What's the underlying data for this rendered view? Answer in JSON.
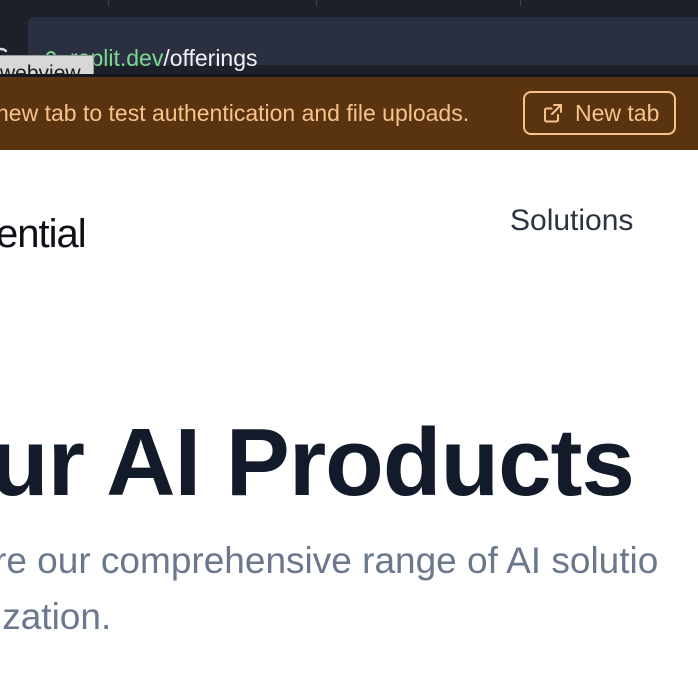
{
  "browser": {
    "url_host": "replit.dev",
    "url_path": "/offerings",
    "tooltip": "webview"
  },
  "banner": {
    "message": "new tab to test authentication and file uploads.",
    "button_label": "New tab"
  },
  "page": {
    "logo_text": "ential",
    "nav_solutions": "Solutions",
    "hero_title": "ur AI Products",
    "hero_subtitle_line1": "re our comprehensive range of AI solutio",
    "hero_subtitle_line2": "ization."
  },
  "icons": {
    "reload": "reload-icon",
    "lock": "lock-icon",
    "external_link": "external-link-icon"
  },
  "colors": {
    "browser_chrome": "#1c2029",
    "url_box": "#2b3040",
    "url_host": "#7bd88f",
    "banner_bg": "#5a3310",
    "banner_text": "#f6c48b",
    "hero_title": "#131a2a",
    "hero_subtitle": "#6b778d"
  }
}
